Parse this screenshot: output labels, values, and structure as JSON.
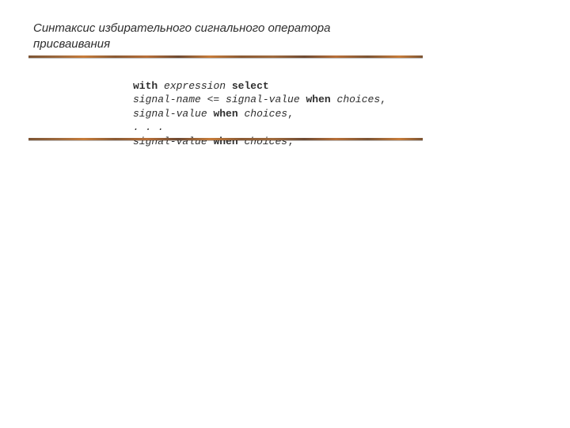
{
  "title": "Синтаксис избирательного сигнального оператора присваивания",
  "code": {
    "l1": {
      "kw_with": "with",
      "expr": "expression",
      "kw_select": "select"
    },
    "l2": {
      "sname": "signal-name",
      "arrow": " <= ",
      "sval": "signal-value",
      "kw_when": "when",
      "ch": "choices",
      "tail": ","
    },
    "l3": {
      "sval": "signal-value",
      "kw_when": "when",
      "ch": "choices",
      "tail": ","
    },
    "l4": {
      "dots": ". . ."
    },
    "l5": {
      "sval": "signal-value",
      "kw_when": "when",
      "ch": "choices",
      "tail": ";"
    }
  }
}
